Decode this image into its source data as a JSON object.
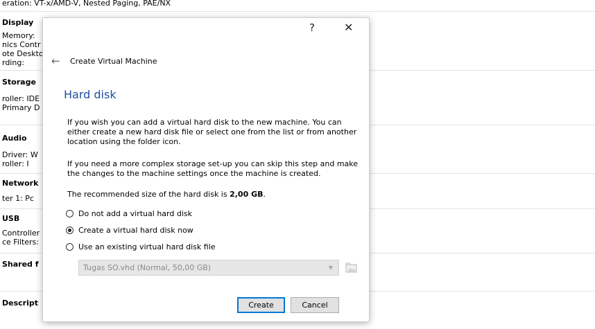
{
  "background": {
    "top_line": "eration:     VT-x/AMD-V, Nested Paging, PAE/NX",
    "sections": [
      {
        "heading": "Display",
        "lines": [
          "Memory:",
          "nics Contr",
          "ote Deskto",
          "rding:"
        ]
      },
      {
        "heading": "Storage",
        "lines": [
          "roller: IDE",
          "Primary D"
        ]
      },
      {
        "heading": "Audio",
        "lines": [
          "Driver:   W",
          "roller:   I"
        ]
      },
      {
        "heading": "Network",
        "lines": [
          "ter 1:  Pc"
        ]
      },
      {
        "heading": "USB",
        "lines": [
          "Controller",
          "ce Filters:"
        ]
      },
      {
        "heading": "Shared f",
        "lines": []
      },
      {
        "heading": "Descript",
        "lines": []
      }
    ]
  },
  "dialog": {
    "help_label": "?",
    "close_label": "✕",
    "back_label": "←",
    "window_title": "Create Virtual Machine",
    "page_title": "Hard disk",
    "para1": "If you wish you can add a virtual hard disk to the new machine. You can either create a new hard disk file or select one from the list or from another location using the folder icon.",
    "para2": "If you need a more complex storage set-up you can skip this step and make the changes to the machine settings once the machine is created.",
    "recommend_prefix": "The recommended size of the hard disk is ",
    "recommend_size": "2,00 GB",
    "recommend_suffix": ".",
    "options": [
      {
        "label": "Do not add a virtual hard disk",
        "checked": false
      },
      {
        "label": "Create a virtual hard disk now",
        "checked": true
      },
      {
        "label": "Use an existing virtual hard disk file",
        "checked": false
      }
    ],
    "disk_file": "Tugas SO.vhd (Normal, 50,00 GB)",
    "create_label": "Create",
    "cancel_label": "Cancel"
  }
}
